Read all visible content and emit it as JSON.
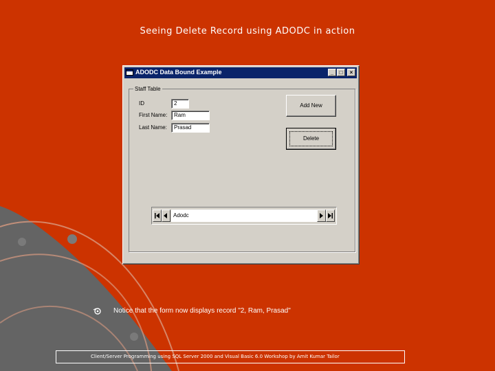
{
  "slide": {
    "title": "Seeing Delete Record using ADODC in action",
    "notice": "Notice that the form now displays record \"2, Ram, Prasad\"",
    "footer": "Client/Server Programming using SQL Server 2000 and Visual Basic 6.0 Workshop by Amit Kumar Tailor"
  },
  "window": {
    "title": "ADODC Data Bound Example",
    "controls": {
      "minimize": "_",
      "maximize": "□",
      "close": "×"
    }
  },
  "form": {
    "group_label": "Staff Table",
    "fields": [
      {
        "label": "ID",
        "value": "2"
      },
      {
        "label": "First Name:",
        "value": "Ram"
      },
      {
        "label": "Last Name:",
        "value": "Prasad"
      }
    ],
    "buttons": {
      "add_new": "Add New",
      "delete": "Delete"
    },
    "adodc": {
      "caption": "Adodc"
    }
  },
  "colors": {
    "slide_background": "#cc3300",
    "form_background": "#d4d0c8",
    "titlebar": "#0a246a"
  },
  "icons": [
    "app-window-icon",
    "bullet-icon",
    "first-record-icon",
    "previous-record-icon",
    "next-record-icon",
    "last-record-icon"
  ]
}
